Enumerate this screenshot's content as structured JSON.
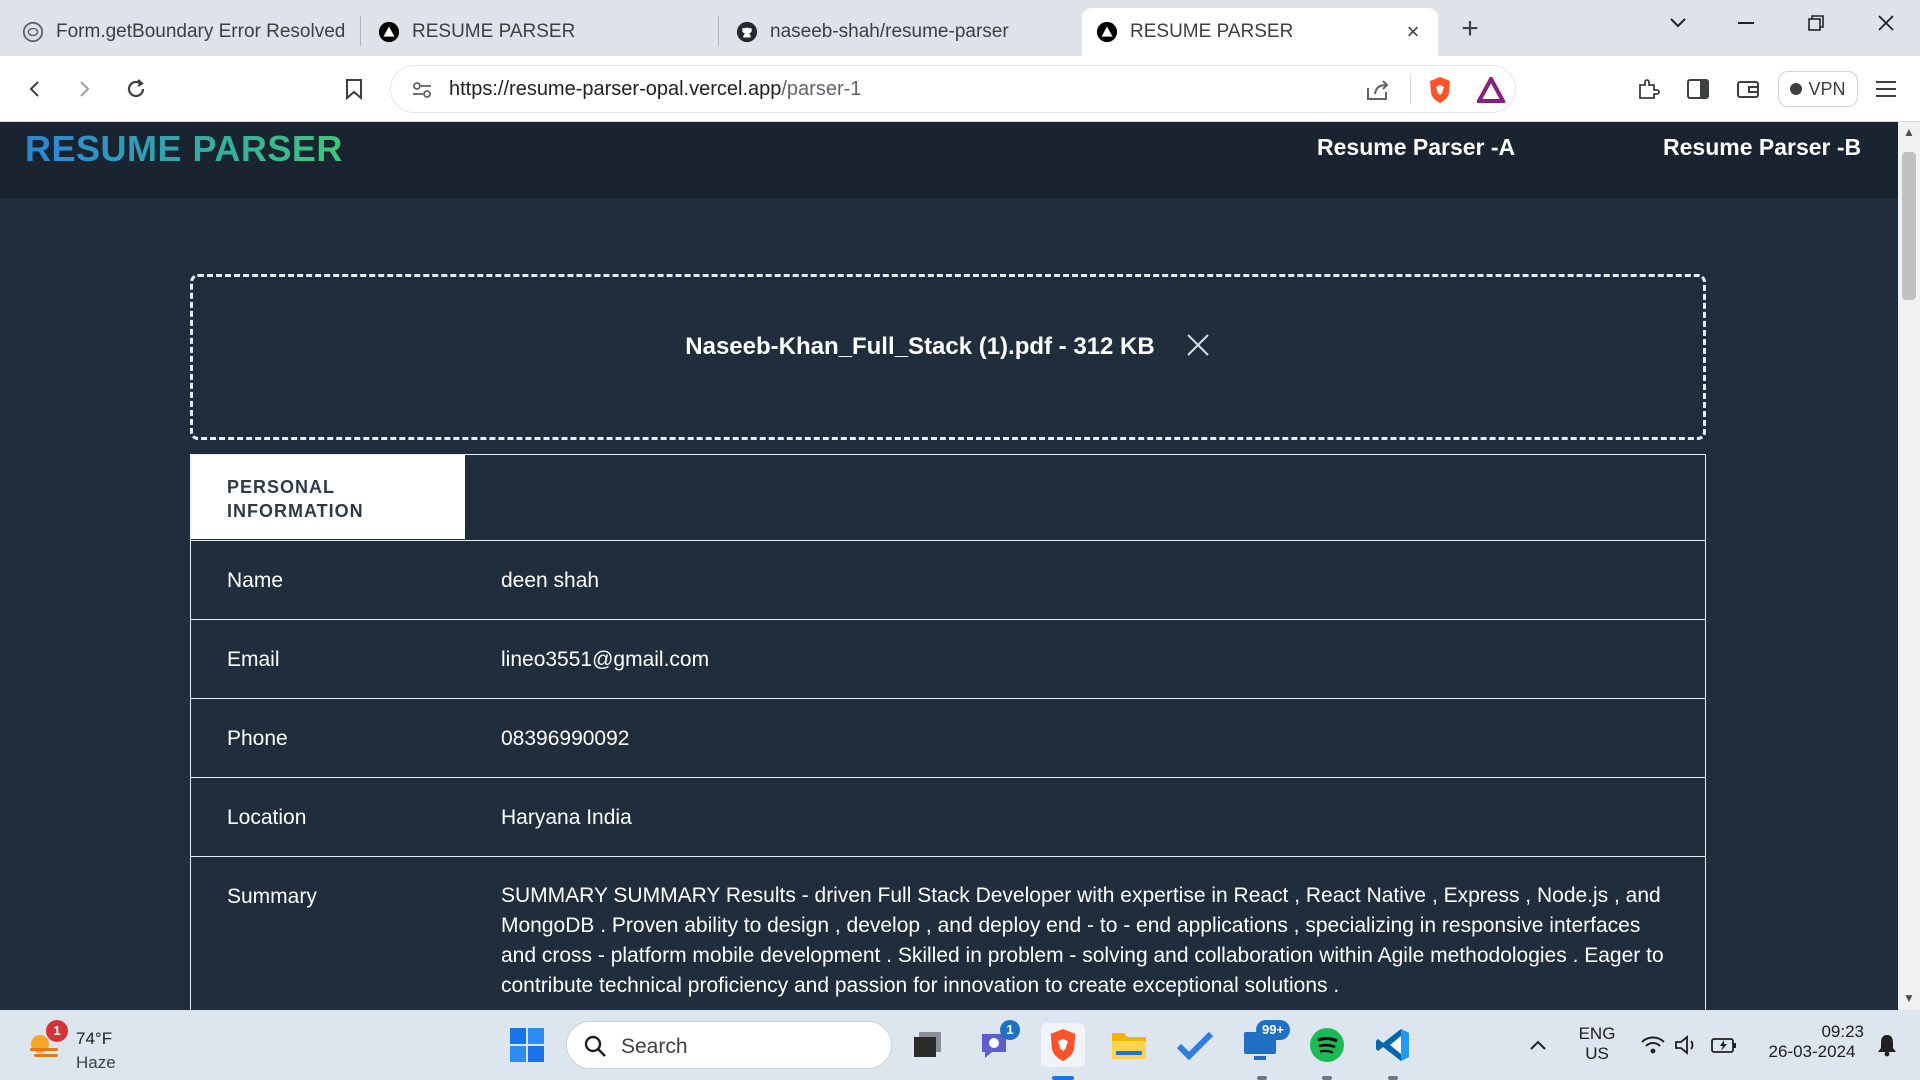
{
  "tabs": [
    {
      "title": "Form.getBoundary Error Resolved",
      "icon": "chatgpt-icon",
      "active": false
    },
    {
      "title": "RESUME PARSER",
      "icon": "vercel-icon",
      "active": false
    },
    {
      "title": "naseeb-shah/resume-parser",
      "icon": "github-icon",
      "active": false
    },
    {
      "title": "RESUME PARSER",
      "icon": "vercel-icon",
      "active": true
    }
  ],
  "toolbar": {
    "url_base": "https://resume-parser-opal.vercel.app",
    "url_path": "/parser-1",
    "vpn_label": "VPN"
  },
  "app": {
    "brand": "RESUME PARSER",
    "nav": [
      "Resume Parser -A",
      "Resume Parser -B"
    ],
    "colors": {
      "brand_gradient_start": "#2a86d8",
      "brand_gradient_end": "#3bc97a",
      "page_bg": "#1f2d3d",
      "navbar_bg": "#1a2430"
    }
  },
  "upload": {
    "file_label": "Naseeb-Khan_Full_Stack (1).pdf - 312 KB"
  },
  "personal_info": {
    "tab_line1": "PERSONAL",
    "tab_line2": "INFORMATION",
    "rows": [
      {
        "label": "Name",
        "value": "deen shah"
      },
      {
        "label": "Email",
        "value": "lineo3551@gmail.com"
      },
      {
        "label": "Phone",
        "value": "08396990092"
      },
      {
        "label": "Location",
        "value": "Haryana India"
      },
      {
        "label": "Summary",
        "value": "SUMMARY SUMMARY Results - driven Full Stack Developer with expertise in React , React Native , Express , Node.js , and MongoDB . Proven ability to design , develop , and deploy end - to - end applications , specializing in responsive interfaces and cross - platform mobile development . Skilled in problem - solving and collaboration within Agile methodologies . Eager to contribute technical proficiency and passion for innovation to create exceptional solutions ."
      }
    ]
  },
  "taskbar": {
    "weather_temp": "74°F",
    "weather_desc": "Haze",
    "weather_badge": "1",
    "search_placeholder": "Search",
    "teams_badge": "1",
    "mail_badge": "99+",
    "lang_line1": "ENG",
    "lang_line2": "US",
    "time": "09:23",
    "date": "26-03-2024"
  }
}
